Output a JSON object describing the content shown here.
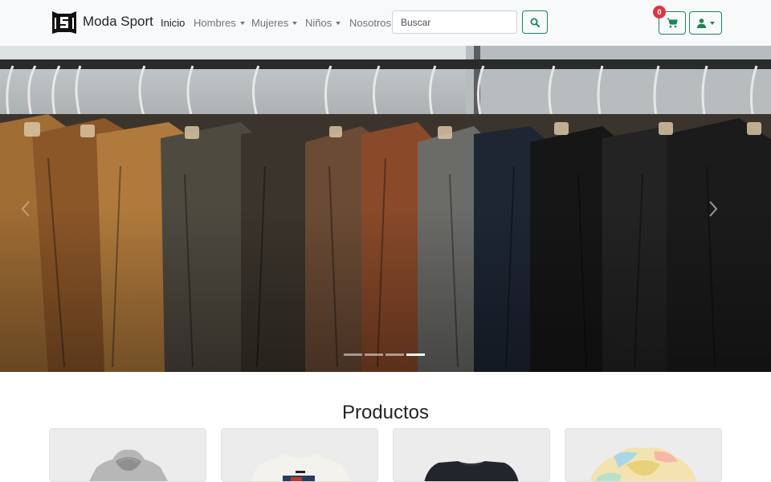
{
  "brand": {
    "name": "Moda Sport",
    "logo_text": "MS"
  },
  "nav": {
    "home": "Inicio",
    "men": "Hombres",
    "women": "Mujeres",
    "kids": "Niños",
    "about": "Nosotros"
  },
  "search": {
    "placeholder": "Buscar"
  },
  "cart": {
    "count": "0"
  },
  "icons": {
    "logo": "moda-sport-logo",
    "search": "search-icon",
    "cart": "cart-icon",
    "user": "user-icon",
    "next": "chevron-right-icon",
    "prev": "chevron-left-icon"
  },
  "carousel": {
    "slide_count": 4,
    "active_index": 3
  },
  "products": {
    "title": "Productos",
    "items": [
      {
        "image": "grey hoodie"
      },
      {
        "image": "white graphic t-shirt"
      },
      {
        "image": "black t-shirt"
      },
      {
        "image": "tie-dye hoodie"
      }
    ]
  },
  "colors": {
    "accent": "#198754",
    "badge": "#dc3545",
    "navbar_bg": "#f8f9fa"
  }
}
